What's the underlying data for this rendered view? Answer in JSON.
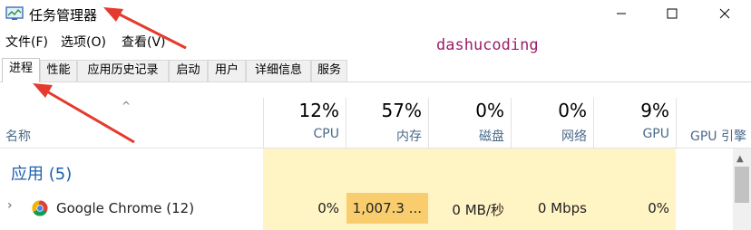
{
  "window": {
    "title": "任务管理器",
    "controls": {
      "minimize": "—",
      "maximize": "☐",
      "close": "✕"
    }
  },
  "menu": [
    "文件(F)",
    "选项(O)",
    "查看(V)"
  ],
  "watermark": "dashucoding",
  "tabs": [
    {
      "label": "进程",
      "active": true
    },
    {
      "label": "性能"
    },
    {
      "label": "应用历史记录"
    },
    {
      "label": "启动"
    },
    {
      "label": "用户"
    },
    {
      "label": "详细信息"
    },
    {
      "label": "服务"
    }
  ],
  "columns": {
    "name": "名称",
    "sort_indicator": "^",
    "cpu": {
      "percent": "12%",
      "label": "CPU"
    },
    "memory": {
      "percent": "57%",
      "label": "内存"
    },
    "disk": {
      "percent": "0%",
      "label": "磁盘"
    },
    "network": {
      "percent": "0%",
      "label": "网络"
    },
    "gpu": {
      "percent": "9%",
      "label": "GPU"
    },
    "gpu_engine": {
      "label": "GPU 引擎"
    }
  },
  "group": {
    "title": "应用 (5)"
  },
  "rows": [
    {
      "name": "Google Chrome (12)",
      "cpu": "0%",
      "memory": "1,007.3 ...",
      "disk": "0 MB/秒",
      "network": "0 Mbps",
      "gpu": "0%",
      "icon": "chrome-icon"
    }
  ],
  "colors": {
    "heat_light": "#fff4c4",
    "heat_mid": "#f9cd6e",
    "group_title": "#1e5fb0",
    "annotation_arrow": "#e53a2e"
  }
}
